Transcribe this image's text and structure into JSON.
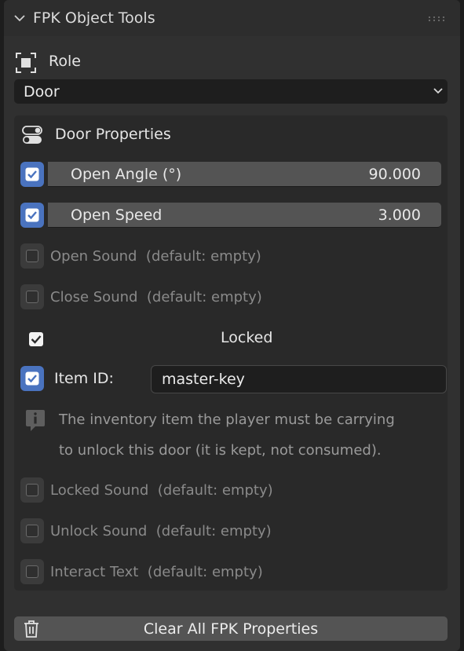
{
  "panel": {
    "title": "FPK Object Tools",
    "collapse_icon": "chevron-down-icon",
    "drag_icon": "grip-dots-icon"
  },
  "role": {
    "label": "Role",
    "icon": "object-frame-icon",
    "selected": "Door"
  },
  "door_properties": {
    "title": "Door Properties",
    "icon": "toggle-switches-icon",
    "open_angle": {
      "label": "Open Angle (°)",
      "value": "90.000",
      "enabled": true
    },
    "open_speed": {
      "label": "Open Speed",
      "value": "3.000",
      "enabled": true
    },
    "open_sound": {
      "label": "Open Sound  (default: empty)",
      "enabled": false
    },
    "close_sound": {
      "label": "Close Sound  (default: empty)",
      "enabled": false
    },
    "locked": {
      "label": "Locked",
      "checked": true
    },
    "item_id": {
      "label": "Item ID:",
      "value": "master-key",
      "enabled": true
    },
    "info": {
      "icon": "info-speech-icon",
      "line1": "The inventory item the player must be carrying",
      "line2": "to unlock this door (it is kept, not consumed)."
    },
    "locked_sound": {
      "label": "Locked Sound  (default: empty)",
      "enabled": false
    },
    "unlock_sound": {
      "label": "Unlock Sound  (default: empty)",
      "enabled": false
    },
    "interact_text": {
      "label": "Interact Text  (default: empty)",
      "enabled": false
    }
  },
  "actions": {
    "clear_label": "Clear All FPK Properties",
    "clear_icon": "trash-icon"
  },
  "colors": {
    "accent": "#4a73bf",
    "panel_bg": "#303030",
    "field_bg": "#545454",
    "input_bg": "#1e1e1e"
  }
}
